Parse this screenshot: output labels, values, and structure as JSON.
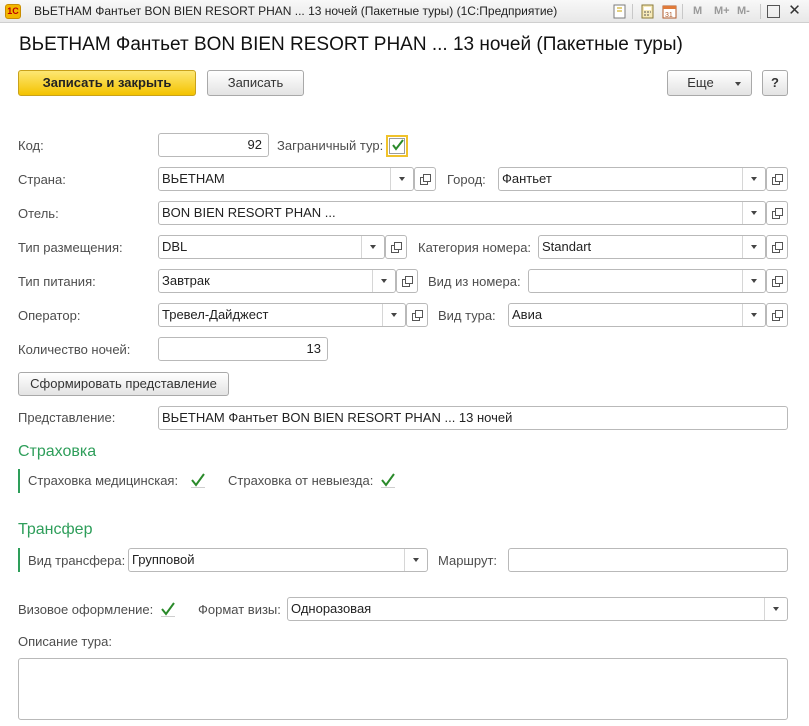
{
  "window": {
    "title": "ВЬЕТНАМ Фантьет BON BIEN RESORT PHAN ... 13 ночей (Пакетные туры)  (1С:Предприятие)",
    "logo_text": "1C",
    "toolbar_letters": [
      "M",
      "M+",
      "M-"
    ],
    "close_glyph": "✕"
  },
  "form": {
    "title": "ВЬЕТНАМ Фантьет BON BIEN RESORT PHAN ... 13 ночей (Пакетные туры)"
  },
  "command_bar": {
    "save_close": "Записать и закрыть",
    "save": "Записать",
    "more": "Еще",
    "help": "?"
  },
  "fields": {
    "kod": {
      "label": "Код:",
      "value": "92"
    },
    "foreign_tour": {
      "label": "Заграничный тур:",
      "checked": true
    },
    "country": {
      "label": "Страна:",
      "value": "ВЬЕТНАМ"
    },
    "city": {
      "label": "Город:",
      "value": "Фантьет"
    },
    "hotel": {
      "label": "Отель:",
      "value": "BON BIEN RESORT PHAN ..."
    },
    "accommodation": {
      "label": "Тип размещения:",
      "value": "DBL"
    },
    "room_category": {
      "label": "Категория номера:",
      "value": "Standart"
    },
    "meal": {
      "label": "Тип питания:",
      "value": "Завтрак"
    },
    "room_view": {
      "label": "Вид из номера:",
      "value": ""
    },
    "operator": {
      "label": "Оператор:",
      "value": "Тревел-Дайджест"
    },
    "tour_type": {
      "label": "Вид тура:",
      "value": "Авиа"
    },
    "nights": {
      "label": "Количество ночей:",
      "value": "13"
    },
    "form_repr_button": "Сформировать представление",
    "representation": {
      "label": "Представление:",
      "value": "ВЬЕТНАМ Фантьет BON BIEN RESORT PHAN ... 13 ночей"
    }
  },
  "insurance": {
    "title": "Страховка",
    "medical": {
      "label": "Страховка медицинская:",
      "checked": true
    },
    "cancel": {
      "label": "Страховка от невыезда:",
      "checked": true
    }
  },
  "transfer": {
    "title": "Трансфер",
    "type": {
      "label": "Вид трансфера:",
      "value": "Групповой"
    },
    "route": {
      "label": "Маршрут:",
      "value": ""
    }
  },
  "visa": {
    "processing": {
      "label": "Визовое оформление:",
      "checked": true
    },
    "format": {
      "label": "Формат визы:",
      "value": "Одноразовая"
    }
  },
  "description": {
    "label": "Описание тура:",
    "value": ""
  },
  "colors": {
    "accent_green": "#2e9e5a",
    "primary_button": "#f4c300",
    "check_green": "#2a8a2a"
  }
}
